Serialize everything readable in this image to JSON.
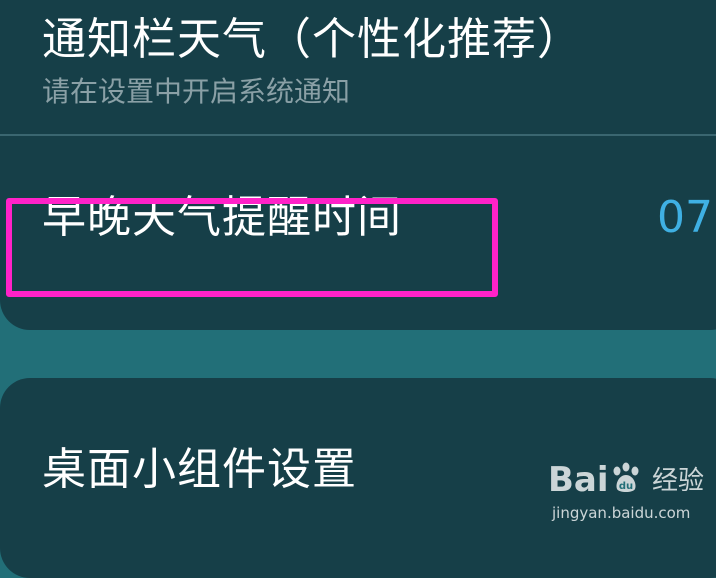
{
  "settings": {
    "notify_weather": {
      "title": "通知栏天气（个性化推荐）",
      "subtitle": "请在设置中开启系统通知"
    },
    "reminder_time": {
      "title": "早晚天气提醒时间",
      "value": "07"
    },
    "widget_settings": {
      "title": "桌面小组件设置"
    }
  },
  "watermark": {
    "logo_text_left": "Bai",
    "logo_text_right": "经验",
    "url": "jingyan.baidu.com"
  },
  "colors": {
    "background": "#226f78",
    "card": "#163f48",
    "accent_value": "#3fb0e3",
    "highlight": "#ff22c8"
  }
}
